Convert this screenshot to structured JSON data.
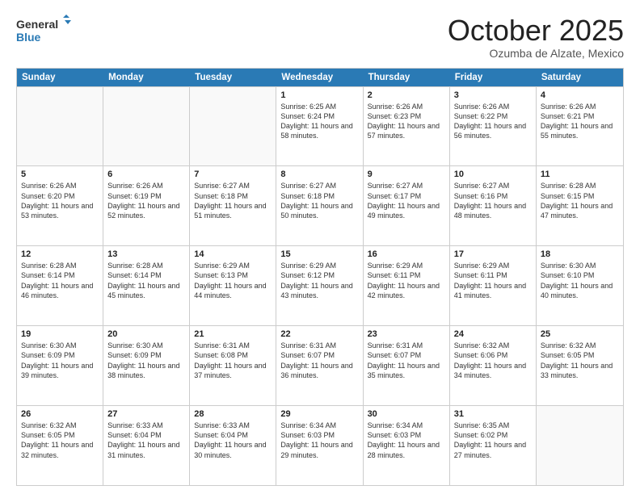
{
  "logo": {
    "line1": "General",
    "line2": "Blue"
  },
  "title": "October 2025",
  "subtitle": "Ozumba de Alzate, Mexico",
  "header_days": [
    "Sunday",
    "Monday",
    "Tuesday",
    "Wednesday",
    "Thursday",
    "Friday",
    "Saturday"
  ],
  "weeks": [
    [
      {
        "day": "",
        "sunrise": "",
        "sunset": "",
        "daylight": ""
      },
      {
        "day": "",
        "sunrise": "",
        "sunset": "",
        "daylight": ""
      },
      {
        "day": "",
        "sunrise": "",
        "sunset": "",
        "daylight": ""
      },
      {
        "day": "1",
        "sunrise": "Sunrise: 6:25 AM",
        "sunset": "Sunset: 6:24 PM",
        "daylight": "Daylight: 11 hours and 58 minutes."
      },
      {
        "day": "2",
        "sunrise": "Sunrise: 6:26 AM",
        "sunset": "Sunset: 6:23 PM",
        "daylight": "Daylight: 11 hours and 57 minutes."
      },
      {
        "day": "3",
        "sunrise": "Sunrise: 6:26 AM",
        "sunset": "Sunset: 6:22 PM",
        "daylight": "Daylight: 11 hours and 56 minutes."
      },
      {
        "day": "4",
        "sunrise": "Sunrise: 6:26 AM",
        "sunset": "Sunset: 6:21 PM",
        "daylight": "Daylight: 11 hours and 55 minutes."
      }
    ],
    [
      {
        "day": "5",
        "sunrise": "Sunrise: 6:26 AM",
        "sunset": "Sunset: 6:20 PM",
        "daylight": "Daylight: 11 hours and 53 minutes."
      },
      {
        "day": "6",
        "sunrise": "Sunrise: 6:26 AM",
        "sunset": "Sunset: 6:19 PM",
        "daylight": "Daylight: 11 hours and 52 minutes."
      },
      {
        "day": "7",
        "sunrise": "Sunrise: 6:27 AM",
        "sunset": "Sunset: 6:18 PM",
        "daylight": "Daylight: 11 hours and 51 minutes."
      },
      {
        "day": "8",
        "sunrise": "Sunrise: 6:27 AM",
        "sunset": "Sunset: 6:18 PM",
        "daylight": "Daylight: 11 hours and 50 minutes."
      },
      {
        "day": "9",
        "sunrise": "Sunrise: 6:27 AM",
        "sunset": "Sunset: 6:17 PM",
        "daylight": "Daylight: 11 hours and 49 minutes."
      },
      {
        "day": "10",
        "sunrise": "Sunrise: 6:27 AM",
        "sunset": "Sunset: 6:16 PM",
        "daylight": "Daylight: 11 hours and 48 minutes."
      },
      {
        "day": "11",
        "sunrise": "Sunrise: 6:28 AM",
        "sunset": "Sunset: 6:15 PM",
        "daylight": "Daylight: 11 hours and 47 minutes."
      }
    ],
    [
      {
        "day": "12",
        "sunrise": "Sunrise: 6:28 AM",
        "sunset": "Sunset: 6:14 PM",
        "daylight": "Daylight: 11 hours and 46 minutes."
      },
      {
        "day": "13",
        "sunrise": "Sunrise: 6:28 AM",
        "sunset": "Sunset: 6:14 PM",
        "daylight": "Daylight: 11 hours and 45 minutes."
      },
      {
        "day": "14",
        "sunrise": "Sunrise: 6:29 AM",
        "sunset": "Sunset: 6:13 PM",
        "daylight": "Daylight: 11 hours and 44 minutes."
      },
      {
        "day": "15",
        "sunrise": "Sunrise: 6:29 AM",
        "sunset": "Sunset: 6:12 PM",
        "daylight": "Daylight: 11 hours and 43 minutes."
      },
      {
        "day": "16",
        "sunrise": "Sunrise: 6:29 AM",
        "sunset": "Sunset: 6:11 PM",
        "daylight": "Daylight: 11 hours and 42 minutes."
      },
      {
        "day": "17",
        "sunrise": "Sunrise: 6:29 AM",
        "sunset": "Sunset: 6:11 PM",
        "daylight": "Daylight: 11 hours and 41 minutes."
      },
      {
        "day": "18",
        "sunrise": "Sunrise: 6:30 AM",
        "sunset": "Sunset: 6:10 PM",
        "daylight": "Daylight: 11 hours and 40 minutes."
      }
    ],
    [
      {
        "day": "19",
        "sunrise": "Sunrise: 6:30 AM",
        "sunset": "Sunset: 6:09 PM",
        "daylight": "Daylight: 11 hours and 39 minutes."
      },
      {
        "day": "20",
        "sunrise": "Sunrise: 6:30 AM",
        "sunset": "Sunset: 6:09 PM",
        "daylight": "Daylight: 11 hours and 38 minutes."
      },
      {
        "day": "21",
        "sunrise": "Sunrise: 6:31 AM",
        "sunset": "Sunset: 6:08 PM",
        "daylight": "Daylight: 11 hours and 37 minutes."
      },
      {
        "day": "22",
        "sunrise": "Sunrise: 6:31 AM",
        "sunset": "Sunset: 6:07 PM",
        "daylight": "Daylight: 11 hours and 36 minutes."
      },
      {
        "day": "23",
        "sunrise": "Sunrise: 6:31 AM",
        "sunset": "Sunset: 6:07 PM",
        "daylight": "Daylight: 11 hours and 35 minutes."
      },
      {
        "day": "24",
        "sunrise": "Sunrise: 6:32 AM",
        "sunset": "Sunset: 6:06 PM",
        "daylight": "Daylight: 11 hours and 34 minutes."
      },
      {
        "day": "25",
        "sunrise": "Sunrise: 6:32 AM",
        "sunset": "Sunset: 6:05 PM",
        "daylight": "Daylight: 11 hours and 33 minutes."
      }
    ],
    [
      {
        "day": "26",
        "sunrise": "Sunrise: 6:32 AM",
        "sunset": "Sunset: 6:05 PM",
        "daylight": "Daylight: 11 hours and 32 minutes."
      },
      {
        "day": "27",
        "sunrise": "Sunrise: 6:33 AM",
        "sunset": "Sunset: 6:04 PM",
        "daylight": "Daylight: 11 hours and 31 minutes."
      },
      {
        "day": "28",
        "sunrise": "Sunrise: 6:33 AM",
        "sunset": "Sunset: 6:04 PM",
        "daylight": "Daylight: 11 hours and 30 minutes."
      },
      {
        "day": "29",
        "sunrise": "Sunrise: 6:34 AM",
        "sunset": "Sunset: 6:03 PM",
        "daylight": "Daylight: 11 hours and 29 minutes."
      },
      {
        "day": "30",
        "sunrise": "Sunrise: 6:34 AM",
        "sunset": "Sunset: 6:03 PM",
        "daylight": "Daylight: 11 hours and 28 minutes."
      },
      {
        "day": "31",
        "sunrise": "Sunrise: 6:35 AM",
        "sunset": "Sunset: 6:02 PM",
        "daylight": "Daylight: 11 hours and 27 minutes."
      },
      {
        "day": "",
        "sunrise": "",
        "sunset": "",
        "daylight": ""
      }
    ]
  ]
}
